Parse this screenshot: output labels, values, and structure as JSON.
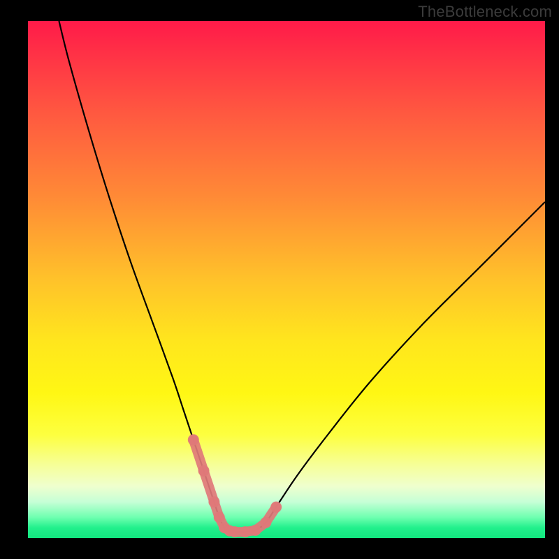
{
  "watermark": "TheBottleneck.com",
  "chart_data": {
    "type": "line",
    "title": "",
    "xlabel": "",
    "ylabel": "",
    "xlim": [
      0,
      100
    ],
    "ylim": [
      0,
      100
    ],
    "series": [
      {
        "name": "bottleneck-curve",
        "x": [
          6,
          8,
          12,
          16,
          20,
          24,
          28,
          30,
          32,
          34,
          36,
          37,
          38,
          39,
          40,
          42,
          44,
          46,
          48,
          52,
          58,
          66,
          76,
          88,
          100
        ],
        "values": [
          100,
          92,
          78,
          65,
          53,
          42,
          31,
          25,
          19,
          13,
          7,
          4,
          2,
          1.4,
          1.2,
          1.2,
          1.5,
          3,
          6,
          12,
          20,
          30,
          41,
          53,
          65
        ]
      }
    ],
    "markers": {
      "name": "bottom-highlight",
      "color": "#e07878",
      "x": [
        32,
        34,
        36,
        37,
        38,
        39,
        40,
        42,
        44,
        46,
        48
      ],
      "values": [
        19,
        13,
        7,
        4,
        2,
        1.4,
        1.2,
        1.2,
        1.5,
        3,
        6
      ]
    },
    "gradient_stops": [
      {
        "pct": 0,
        "color": "#ff1a49"
      },
      {
        "pct": 50,
        "color": "#ffc22a"
      },
      {
        "pct": 80,
        "color": "#fdff3f"
      },
      {
        "pct": 100,
        "color": "#12e67f"
      }
    ]
  }
}
